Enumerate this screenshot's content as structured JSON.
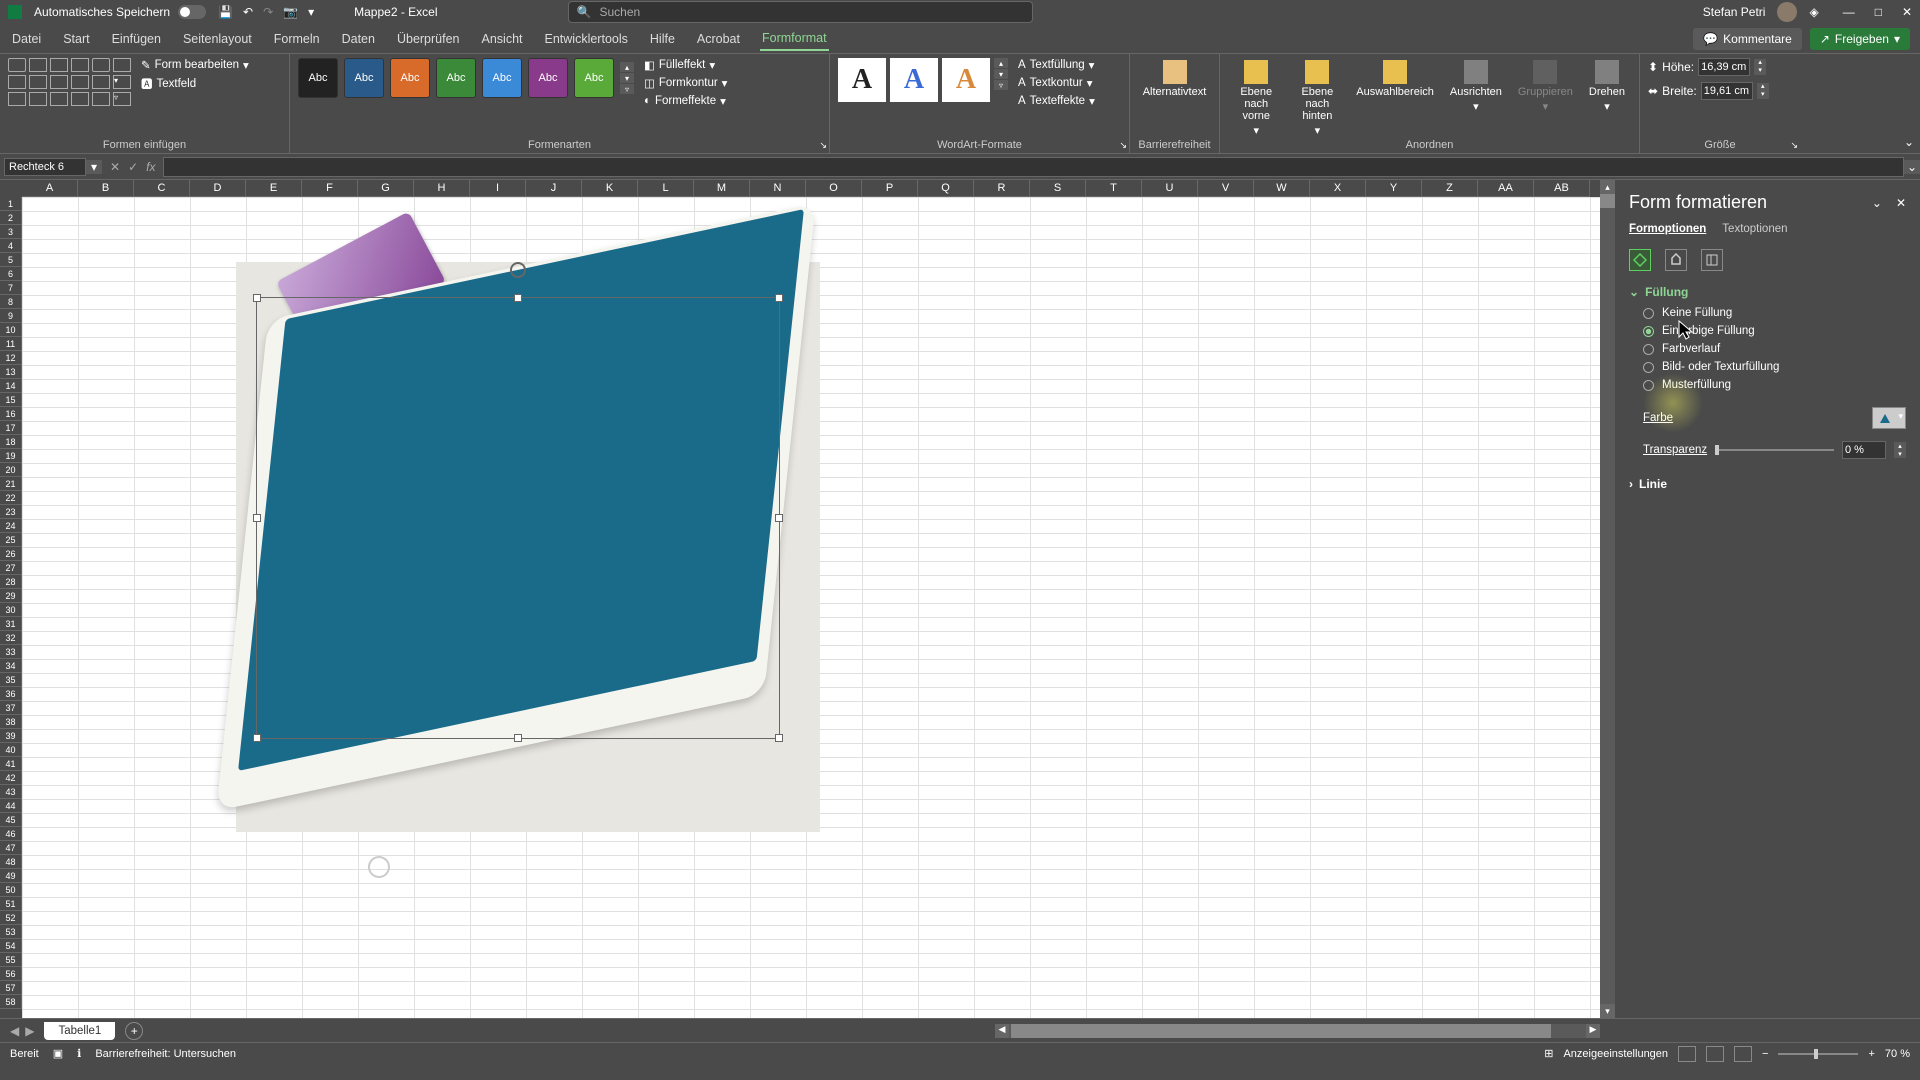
{
  "titlebar": {
    "autosave_label": "Automatisches Speichern",
    "doc_title": "Mappe2 - Excel",
    "search_placeholder": "Suchen",
    "user_name": "Stefan Petri"
  },
  "tabs": {
    "datei": "Datei",
    "start": "Start",
    "einfuegen": "Einfügen",
    "seitenlayout": "Seitenlayout",
    "formeln": "Formeln",
    "daten": "Daten",
    "ueberpruefen": "Überprüfen",
    "ansicht": "Ansicht",
    "entwicklertools": "Entwicklertools",
    "hilfe": "Hilfe",
    "acrobat": "Acrobat",
    "formformat": "Formformat",
    "kommentare": "Kommentare",
    "freigeben": "Freigeben"
  },
  "ribbon": {
    "form_bearbeiten": "Form bearbeiten",
    "textfeld": "Textfeld",
    "formen_einfuegen": "Formen einfügen",
    "style_label": "Abc",
    "fuelleffekt": "Fülleffekt",
    "formkontur": "Formkontur",
    "formeffekte": "Formeffekte",
    "formenarten": "Formenarten",
    "textfuellung": "Textfüllung",
    "textkontur": "Textkontur",
    "texteffekte": "Texteffekte",
    "wordart": "WordArt-Formate",
    "alternativtext": "Alternativtext",
    "barrierefreiheit": "Barrierefreiheit",
    "ebene_vorne": "Ebene nach vorne",
    "ebene_hinten": "Ebene nach hinten",
    "auswahlbereich": "Auswahlbereich",
    "ausrichten": "Ausrichten",
    "gruppieren": "Gruppieren",
    "drehen": "Drehen",
    "anordnen": "Anordnen",
    "hoehe": "Höhe:",
    "hoehe_value": "16,39 cm",
    "breite": "Breite:",
    "breite_value": "19,61 cm",
    "groesse": "Größe"
  },
  "formula": {
    "name_box": "Rechteck 6",
    "fx": "fx"
  },
  "columns": [
    "A",
    "B",
    "C",
    "D",
    "E",
    "F",
    "G",
    "H",
    "I",
    "J",
    "K",
    "L",
    "M",
    "N",
    "O",
    "P",
    "Q",
    "R",
    "S",
    "T",
    "U",
    "V",
    "W",
    "X",
    "Y",
    "Z",
    "AA",
    "AB"
  ],
  "pane": {
    "title": "Form formatieren",
    "formoptionen": "Formoptionen",
    "textoptionen": "Textoptionen",
    "fuellung": "Füllung",
    "keine": "Keine Füllung",
    "einfarbige": "Einfarbige Füllung",
    "farbverlauf": "Farbverlauf",
    "bild": "Bild- oder Texturfüllung",
    "muster": "Musterfüllung",
    "farbe": "Farbe",
    "transparenz": "Transparenz",
    "transparenz_value": "0 %",
    "linie": "Linie"
  },
  "sheet": {
    "tab1": "Tabelle1"
  },
  "status": {
    "bereit": "Bereit",
    "accessibility": "Barrierefreiheit: Untersuchen",
    "anzeige": "Anzeigeeinstellungen",
    "zoom": "70 %"
  },
  "colors": {
    "style1": "#222222",
    "style2": "#2a5a8a",
    "style3": "#d86a2a",
    "style4": "#3a8a3a",
    "style5": "#3a8ad8",
    "style6": "#8a3a8a",
    "style7": "#5aaa3a",
    "wa1": "#222222",
    "wa2": "#3a6ad8",
    "wa3": "#d88a3a"
  }
}
